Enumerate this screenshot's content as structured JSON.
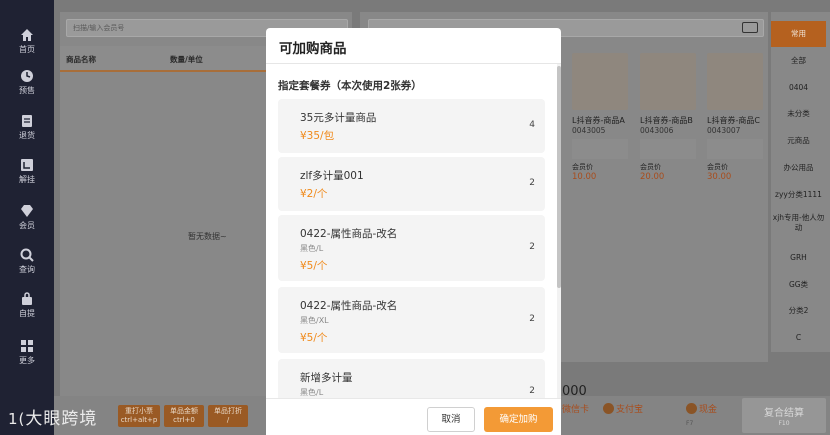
{
  "nav": [
    {
      "label": "首页",
      "icon": "home-icon"
    },
    {
      "label": "预售",
      "icon": "clock-icon"
    },
    {
      "label": "退货",
      "icon": "document-icon"
    },
    {
      "label": "解挂",
      "icon": "unhold-icon"
    },
    {
      "label": "会员",
      "icon": "diamond-icon"
    },
    {
      "label": "查询",
      "icon": "search-icon"
    },
    {
      "label": "自提",
      "icon": "bag-icon"
    },
    {
      "label": "更多",
      "icon": "grid-icon"
    }
  ],
  "left_panel": {
    "search_placeholder": "扫描/输入会员号",
    "col_name": "商品名称",
    "col_qty": "数量/单位",
    "empty": "暂无数据~"
  },
  "products": [
    {
      "name": "L抖音券-商品A",
      "code": "0043005",
      "price_label": "会员价",
      "price": "10.00"
    },
    {
      "name": "L抖音券-商品B",
      "code": "0043006",
      "price_label": "会员价",
      "price": "20.00"
    },
    {
      "name": "L抖音券-商品C",
      "code": "0043007",
      "price_label": "会员价",
      "price": "30.00"
    }
  ],
  "categories": [
    "常用",
    "全部",
    "0404",
    "未分类",
    "元商品",
    "办公用品",
    "zyy分类1111",
    "xjh专用-他人勿动",
    "GRH",
    "GG类",
    "分类2",
    "C"
  ],
  "hotkeys": [
    {
      "label": "重打小票",
      "key": "ctrl+alt+p"
    },
    {
      "label": "单品金额",
      "key": "ctrl+0"
    },
    {
      "label": "单品打折",
      "key": "/"
    }
  ],
  "footer_bar": {
    "total": "000",
    "pay_options": [
      {
        "label": "微信卡",
        "key": ""
      },
      {
        "label": "支付宝",
        "key": ""
      },
      {
        "label": "现金",
        "key": "F7"
      }
    ],
    "settle_label": "复合结算",
    "settle_key": "F10"
  },
  "watermark": "大眼跨境",
  "modal": {
    "title": "可加购商品",
    "section": "指定套餐券（本次使用2张券）",
    "items": [
      {
        "name": "35元多计量商品",
        "spec": "",
        "price": "¥35/包",
        "qty": "4"
      },
      {
        "name": "zlf多计量001",
        "spec": "",
        "price": "¥2/个",
        "qty": "2"
      },
      {
        "name": "0422-属性商品-改名",
        "spec": "黑色/L",
        "price": "¥5/个",
        "qty": "2"
      },
      {
        "name": "0422-属性商品-改名",
        "spec": "黑色/XL",
        "price": "¥5/个",
        "qty": "2"
      },
      {
        "name": "新增多计量",
        "spec": "黑色/L",
        "price": "",
        "qty": "2"
      }
    ],
    "cancel_label": "取消",
    "confirm_label": "确定加购"
  },
  "colors": {
    "accent": "#f39a36",
    "price": "#f08a1b",
    "nav_bg": "#1f2233"
  }
}
